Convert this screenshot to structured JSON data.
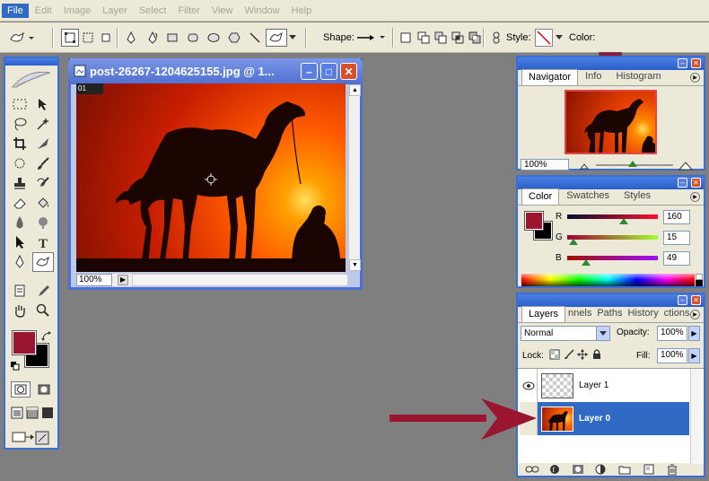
{
  "menu": [
    "File",
    "Edit",
    "Image",
    "Layer",
    "Select",
    "Filter",
    "View",
    "Window",
    "Help"
  ],
  "options": {
    "shape_label": "Shape:",
    "style_label": "Style:",
    "color_label": "Color:",
    "color_value": "#9a1530"
  },
  "image_window": {
    "title": "post-26267-1204625155.jpg @ 1...",
    "ruler_label": "01",
    "zoom": "100%"
  },
  "navigator": {
    "tabs": [
      "Navigator",
      "Info",
      "Histogram"
    ],
    "active_tab": "Navigator",
    "zoom": "100%"
  },
  "color_panel": {
    "tabs": [
      "Color",
      "Swatches",
      "Styles"
    ],
    "active_tab": "Color",
    "channels": [
      {
        "label": "R",
        "value": "160"
      },
      {
        "label": "G",
        "value": "15"
      },
      {
        "label": "B",
        "value": "49"
      }
    ],
    "foreground": "#9a1530",
    "background": "#000000"
  },
  "layers_panel": {
    "tabs": [
      "Layers",
      "nnels",
      "Paths",
      "History",
      "ctions"
    ],
    "active_tab": "Layers",
    "blend_mode": "Normal",
    "opacity_label": "Opacity:",
    "opacity": "100%",
    "lock_label": "Lock:",
    "fill_label": "Fill:",
    "fill": "100%",
    "layers": [
      {
        "name": "Layer 1",
        "visible": true,
        "selected": false
      },
      {
        "name": "Layer 0",
        "visible": false,
        "selected": true
      }
    ]
  },
  "tools": {
    "foreground": "#9a1530",
    "background": "#000000"
  },
  "annotation_arrow_color": "#9a1530"
}
